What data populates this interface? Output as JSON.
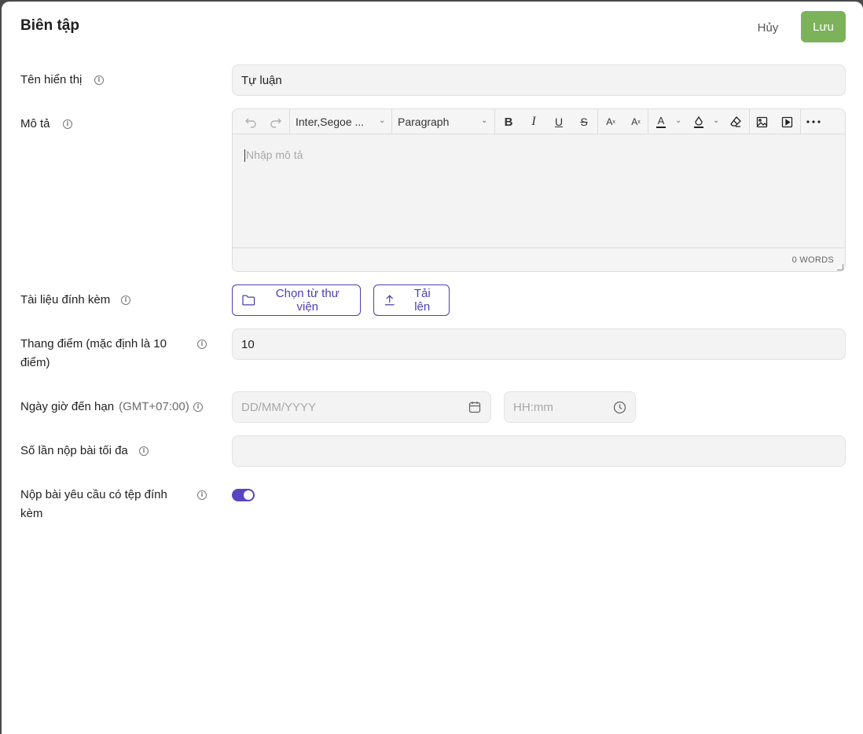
{
  "header": {
    "title": "Biên tập",
    "cancel_label": "Hủy",
    "save_label": "Lưu"
  },
  "fields": {
    "display_name": {
      "label": "Tên hiển thị",
      "value": "Tự luận"
    },
    "description": {
      "label": "Mô tả",
      "font": "Inter,Segoe ...",
      "block": "Paragraph",
      "placeholder": "Nhập mô tả",
      "word_count": "0 WORDS"
    },
    "attachments": {
      "label": "Tài liệu đính kèm",
      "library_button": "Chọn từ thư viện",
      "upload_button": "Tải lên"
    },
    "score_scale": {
      "label": "Thang điểm (mặc định là 10 điểm)",
      "value": "10"
    },
    "due_date": {
      "label": "Ngày giờ đến hạn",
      "timezone": "(GMT+07:00)",
      "date_placeholder": "DD/MM/YYYY",
      "time_placeholder": "HH:mm"
    },
    "max_submissions": {
      "label": "Số lần nộp bài tối đa",
      "value": ""
    },
    "require_file": {
      "label": "Nộp bài yêu cầu có tệp đính kèm",
      "enabled": true
    }
  },
  "colors": {
    "save": "#7cb35a",
    "accent": "#4b3fb5",
    "toggle": "#5a45c0"
  },
  "icons": [
    "info-icon",
    "undo-icon",
    "redo-icon",
    "bold-icon",
    "italic-icon",
    "underline-icon",
    "strikethrough-icon",
    "superscript-icon",
    "subscript-icon",
    "text-color-icon",
    "highlight-icon",
    "clear-format-icon",
    "image-icon",
    "video-icon",
    "more-icon",
    "folder-icon",
    "upload-icon",
    "calendar-icon",
    "clock-icon"
  ]
}
